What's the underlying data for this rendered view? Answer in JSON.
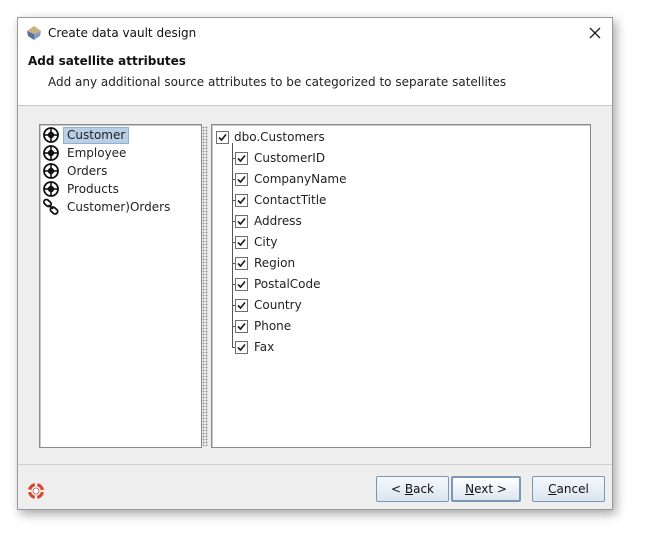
{
  "window": {
    "title": "Create data vault design"
  },
  "header": {
    "title": "Add satellite attributes",
    "subtitle": "Add any additional source attributes to be categorized to separate satellites"
  },
  "entities": [
    {
      "label": "Customer",
      "icon": "hub-icon",
      "selected": true
    },
    {
      "label": "Employee",
      "icon": "hub-icon",
      "selected": false
    },
    {
      "label": "Orders",
      "icon": "hub-icon",
      "selected": false
    },
    {
      "label": "Products",
      "icon": "hub-icon",
      "selected": false
    },
    {
      "label": "Customer)Orders",
      "icon": "link-icon",
      "selected": false
    }
  ],
  "tree": {
    "root": {
      "label": "dbo.Customers",
      "checked": true
    },
    "children": [
      {
        "label": "CustomerID",
        "checked": true
      },
      {
        "label": "CompanyName",
        "checked": true
      },
      {
        "label": "ContactTitle",
        "checked": true
      },
      {
        "label": "Address",
        "checked": true
      },
      {
        "label": "City",
        "checked": true
      },
      {
        "label": "Region",
        "checked": true
      },
      {
        "label": "PostalCode",
        "checked": true
      },
      {
        "label": "Country",
        "checked": true
      },
      {
        "label": "Phone",
        "checked": true
      },
      {
        "label": "Fax",
        "checked": true
      }
    ]
  },
  "buttons": {
    "back": {
      "prefix": "< ",
      "mnemonic": "B",
      "rest": "ack"
    },
    "next": {
      "prefix": "",
      "mnemonic": "N",
      "rest": "ext >"
    },
    "cancel": {
      "prefix": "",
      "mnemonic": "C",
      "rest": "ancel"
    }
  },
  "colors": {
    "selection": "#b8cfe5",
    "button_border": "#7a98b5",
    "help_icon": "#e0412c"
  }
}
